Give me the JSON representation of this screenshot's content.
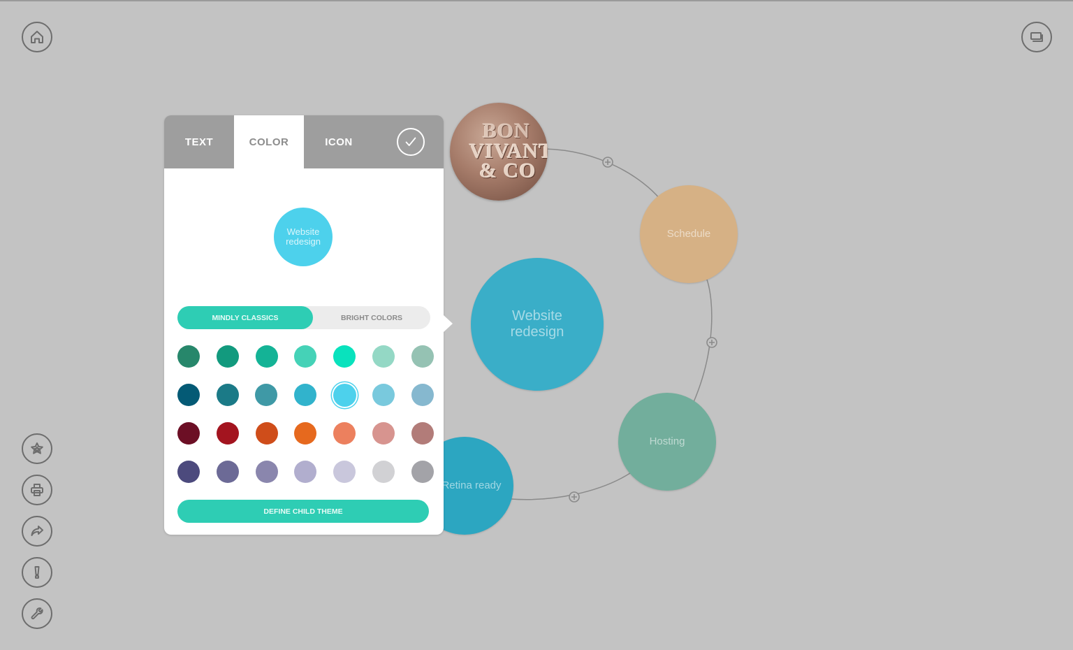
{
  "toolbar": {
    "top_left": [
      {
        "name": "home-button",
        "icon": "home-icon"
      }
    ],
    "top_right": [
      {
        "name": "presentation-button",
        "icon": "slides-icon"
      }
    ],
    "left_bottom": [
      {
        "name": "favorites-button",
        "icon": "star-icon"
      },
      {
        "name": "print-button",
        "icon": "printer-icon"
      },
      {
        "name": "share-button",
        "icon": "share-icon"
      },
      {
        "name": "tips-button",
        "icon": "exclamation-icon"
      },
      {
        "name": "settings-button",
        "icon": "wrench-icon"
      }
    ]
  },
  "editor_panel": {
    "tabs": [
      {
        "label": "TEXT",
        "active": false
      },
      {
        "label": "COLOR",
        "active": true
      },
      {
        "label": "ICON",
        "active": false
      }
    ],
    "confirm_icon": "checkmark-icon",
    "preview": {
      "label": "Website redesign",
      "color": "#4dd1ec"
    },
    "palette_tabs": [
      {
        "label": "MINDLY CLASSICS",
        "active": true
      },
      {
        "label": "BRIGHT COLORS",
        "active": false
      }
    ],
    "swatches": [
      [
        "#27876b",
        "#129a7e",
        "#14b396",
        "#45d2b7",
        "#09e2bd",
        "#94d8c5",
        "#95c2b3"
      ],
      [
        "#045a75",
        "#1b7a87",
        "#3f99a6",
        "#31b3cc",
        "#4dd1ec",
        "#79c9dd",
        "#86b8cf"
      ],
      [
        "#6c0f25",
        "#a3141f",
        "#cf4d1a",
        "#e6691e",
        "#ec805e",
        "#d7948f",
        "#b27c79"
      ],
      [
        "#4c4a7d",
        "#6c6a96",
        "#8a86ad",
        "#b1aece",
        "#c9c7dc",
        "#d1d1d4",
        "#a3a3a8"
      ]
    ],
    "selected_swatch": {
      "row": 1,
      "col": 4
    },
    "define_button_label": "DEFINE CHILD THEME",
    "accent_color": "#2ecdb4"
  },
  "mind_map": {
    "center": {
      "label": "Website redesign",
      "color": "#3aaec8"
    },
    "children": [
      {
        "label": "",
        "type": "image",
        "image_text": [
          "BON",
          "VIVANT",
          "& CO"
        ]
      },
      {
        "label": "Schedule",
        "color": "#d6b185"
      },
      {
        "label": "Hosting",
        "color": "#72ae9c"
      },
      {
        "label": "Retina ready",
        "color": "#2ca6c1"
      }
    ]
  }
}
